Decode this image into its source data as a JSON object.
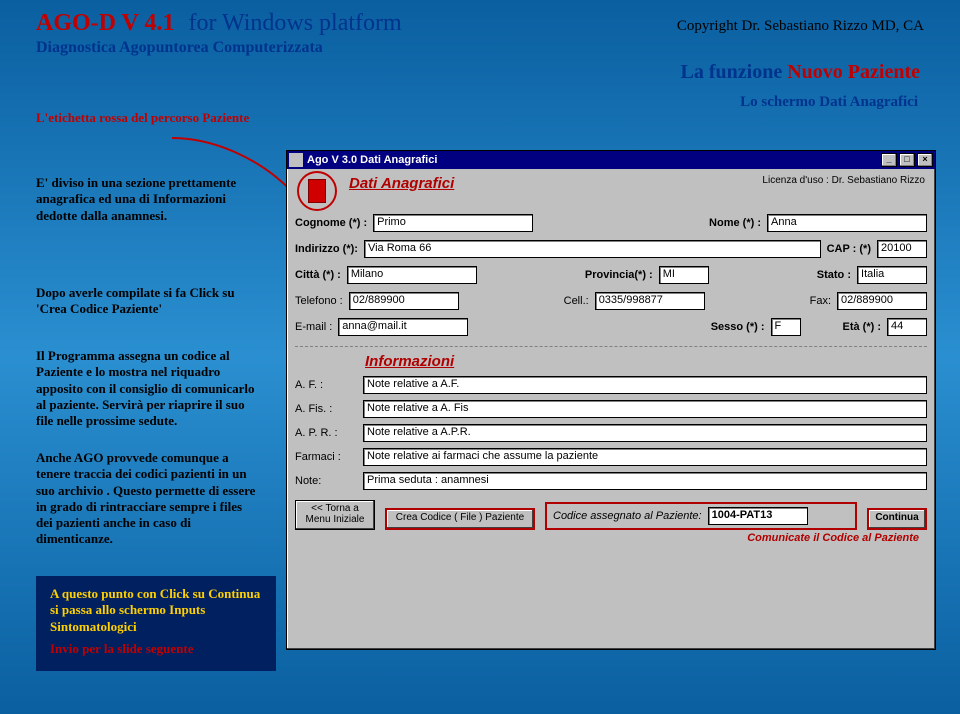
{
  "header": {
    "title_red": "AGO-D V 4.1",
    "title_blue": "for Windows platform",
    "copyright": "Copyright Dr. Sebastiano Rizzo MD, CA",
    "subtitle": "Diagnostica Agopuntorea Computerizzata",
    "func_prefix": "La funzione ",
    "func_red": "Nuovo Paziente",
    "lo_schermo": "Lo schermo Dati Anagrafici"
  },
  "side": {
    "s1": "L'etichetta rossa del percorso Paziente",
    "s2": "E' diviso in una sezione prettamente anagrafica ed una di Informazioni dedotte dalla anamnesi.",
    "s3": "Dopo averle compilate  si fa Click su 'Crea Codice Paziente'",
    "s4": "Il Programma assegna un codice al Paziente e lo mostra nel riquadro apposito con il consiglio di comunicarlo al paziente. Servirà per riaprire il suo file nelle prossime sedute.",
    "s5": "Anche AGO  provvede comunque a tenere traccia dei codici  pazienti in un suo archivio . Questo permette di essere in grado di rintracciare  sempre  i  files dei pazienti anche  in caso di dimenticanze.",
    "s6a": "A questo punto con Click su Continua si passa allo schermo Inputs Sintomatologici",
    "s6b": "Invio per la slide seguente"
  },
  "win": {
    "title": "Ago V 3.0 Dati Anagrafici",
    "section1": "Dati Anagrafici",
    "licenza_lbl": "Licenza d'uso : ",
    "licenza_val": "Dr. Sebastiano Rizzo",
    "labels": {
      "cognome": "Cognome (*) :",
      "nome": "Nome (*) :",
      "indirizzo": "Indirizzo (*):",
      "cap": "CAP : (*)",
      "citta": "Città (*) :",
      "provincia": "Provincia(*) :",
      "stato": "Stato :",
      "telefono": "Telefono :",
      "cell": "Cell.:",
      "fax": "Fax:",
      "email": "E-mail :",
      "sesso": "Sesso (*) :",
      "eta": "Età (*) :"
    },
    "values": {
      "cognome": "Primo",
      "nome": "Anna",
      "indirizzo": "Via Roma 66",
      "cap": "20100",
      "citta": "Milano",
      "provincia": "MI",
      "stato": "Italia",
      "telefono": "02/889900",
      "cell": "0335/998877",
      "fax": "02/889900",
      "email": "anna@mail.it",
      "sesso": "F",
      "eta": "44"
    },
    "section2": "Informazioni",
    "info_labels": {
      "af": "A. F. :",
      "afis": "A. Fis. :",
      "apr": "A. P. R. :",
      "farmaci": "Farmaci :",
      "note": "Note:"
    },
    "info_values": {
      "af": "Note relative a A.F.",
      "afis": "Note relative a A. Fis",
      "apr": "Note relative a A.P.R.",
      "farmaci": "Note relative ai farmaci che assume la paziente",
      "note": "Prima seduta : anamnesi"
    },
    "buttons": {
      "back": "<< Torna a Menu Iniziale",
      "crea": "Crea Codice ( File ) Paziente",
      "cod_lbl": "Codice assegnato al Paziente:",
      "cod_val": "1004-PAT13",
      "continua": "Continua"
    },
    "communicate": "Comunicate il Codice al Paziente"
  }
}
